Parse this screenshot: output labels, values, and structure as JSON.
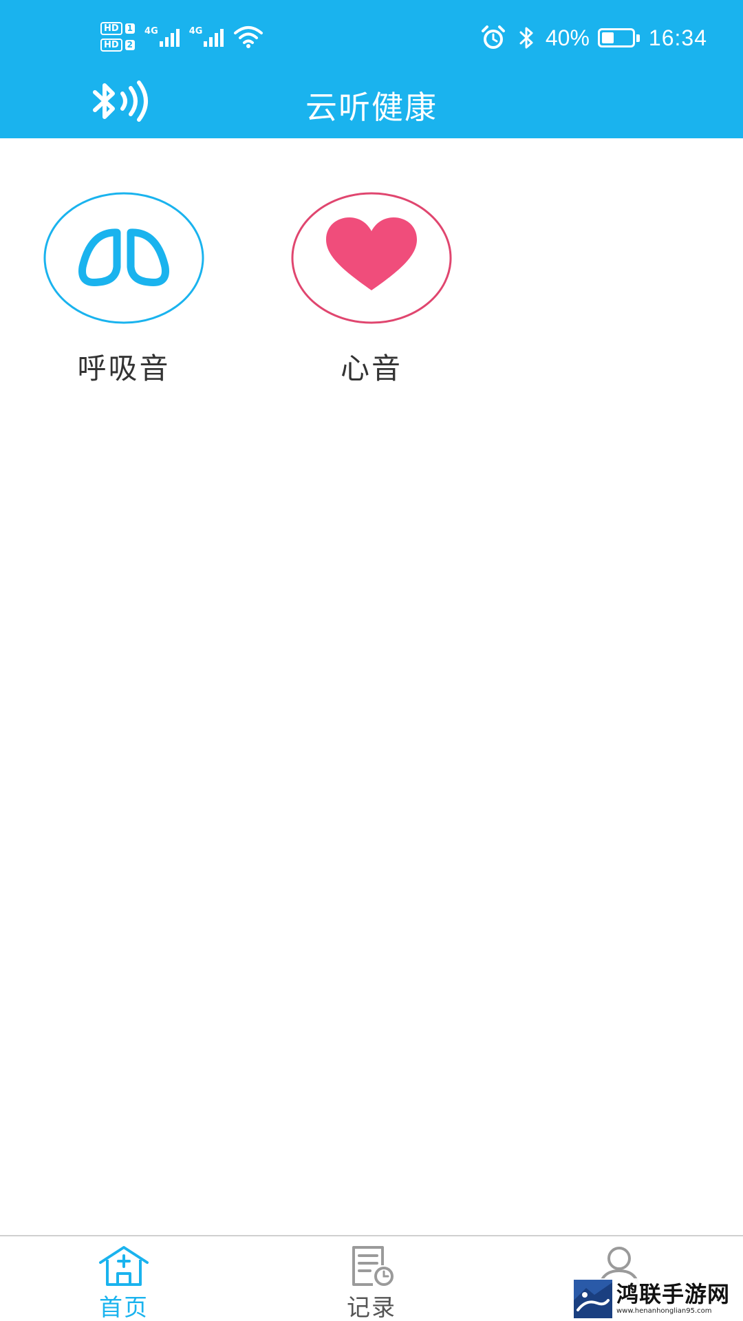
{
  "status_bar": {
    "sim1_badge": "HD",
    "sim1_slot": "1",
    "sim2_badge": "HD",
    "sim2_slot": "2",
    "net1_label": "4G",
    "net2_label": "4G",
    "battery_percent": "40%",
    "battery_level": 0.4,
    "time": "16:34",
    "icons": [
      "alarm-icon",
      "bluetooth-icon",
      "wifi-icon",
      "signal-icon",
      "battery-icon"
    ]
  },
  "app_bar": {
    "title": "云听健康",
    "left_icon": "bluetooth-sound-icon"
  },
  "features": [
    {
      "label": "呼吸音",
      "icon": "lungs-icon",
      "color": "#1ab3ee"
    },
    {
      "label": "心音",
      "icon": "heart-icon",
      "color": "#e0466f"
    }
  ],
  "bottom_nav": {
    "active_color": "#1ab3ee",
    "items": [
      {
        "label": "首页",
        "icon": "home-icon",
        "active": true
      },
      {
        "label": "记录",
        "icon": "records-icon",
        "active": false
      },
      {
        "label": "",
        "icon": "user-icon",
        "active": false
      }
    ]
  },
  "watermark": {
    "name": "鸿联手游网",
    "url": "www.henanhonglian95.com"
  }
}
